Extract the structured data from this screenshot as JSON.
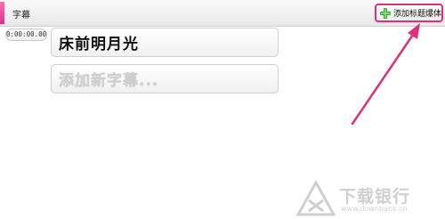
{
  "panel": {
    "title": "字幕",
    "add_button_label": "添加标题爆体"
  },
  "subtitles": [
    {
      "timecode": "0:00:00.00",
      "text": "床前明月光"
    },
    {
      "timecode": "",
      "text": "添加新字幕..."
    }
  ],
  "watermark": {
    "brand": "下载银行",
    "url": "www.downbank.cn"
  },
  "colors": {
    "accent_pink": "#e0307a",
    "plus_green": "#3aa537"
  }
}
